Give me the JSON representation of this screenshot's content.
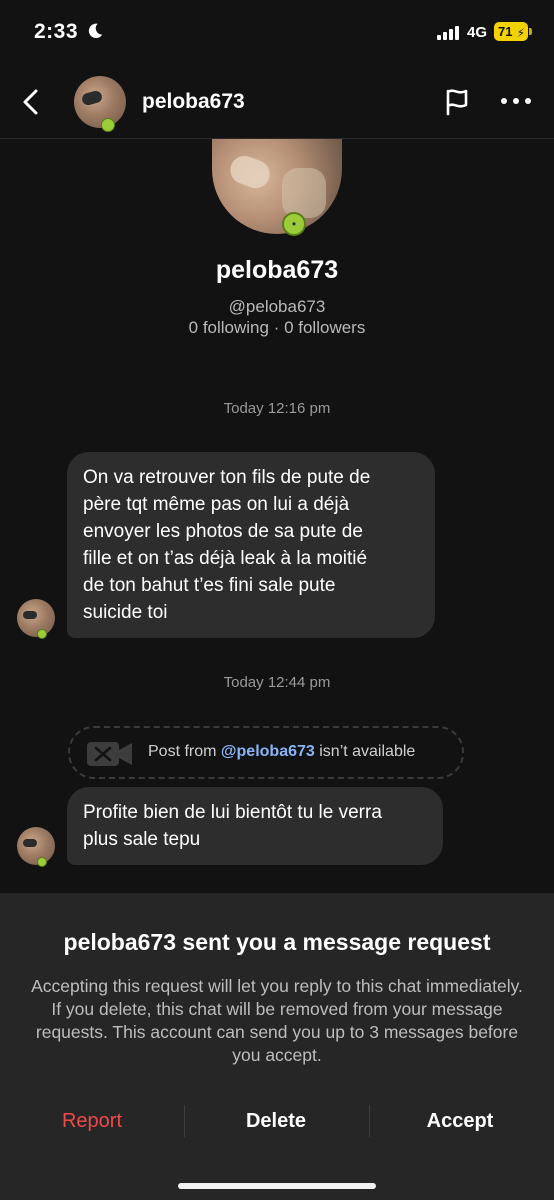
{
  "status_bar": {
    "time": "2:33",
    "network": "4G",
    "battery": "71"
  },
  "header": {
    "username": "peloba673"
  },
  "profile": {
    "name": "peloba673",
    "handle": "@peloba673",
    "stats": "0 following · 0 followers"
  },
  "chat": {
    "messages_1_time": "Today 12:16 pm",
    "message_1": "On va retrouver ton fils de pute de\npère tqt même pas on lui a déjà\nenvoyer les photos de sa pute de\nfille et on t’as déjà leak à la moitié\nde ton bahut t’es fini sale pute\nsuicide toi",
    "messages_2_time": "Today 12:44 pm",
    "unavailable_prefix": "Post from",
    "unavailable_user": "@peloba673",
    "unavailable_suffix": "isn’t available",
    "message_2": "Profite bien de lui bientôt tu le verra\nplus sale tepu"
  },
  "request_sheet": {
    "title": "peloba673 sent you a message request",
    "body": "Accepting this request will let you reply to this chat immediately. If you delete, this chat will be removed from your message requests. This account can send you up to 3 messages before you accept.",
    "report_label": "Report",
    "delete_label": "Delete",
    "accept_label": "Accept"
  },
  "colors": {
    "background": "#121212",
    "bubble": "#2d2d2d",
    "sheet": "#262626",
    "report": "#ef4a4a",
    "link": "#8ab4f8",
    "battery": "#f2d200"
  },
  "icons": [
    "moon-icon",
    "signal-icon",
    "chevron-left-icon",
    "flag-icon",
    "more-dots-icon",
    "camera-off-icon"
  ]
}
